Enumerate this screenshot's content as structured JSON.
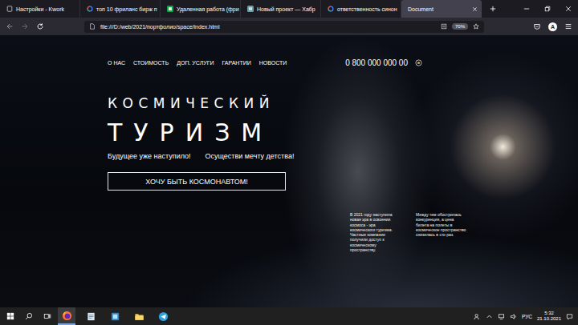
{
  "browser": {
    "tabs": [
      {
        "label": "Настройки - Kwork",
        "kind": "kwork",
        "selected": false
      },
      {
        "label": "топ 10 фриланс бирж п",
        "kind": "google",
        "selected": false
      },
      {
        "label": "Удаленная работа (фри",
        "kind": "fl",
        "selected": false
      },
      {
        "label": "Новый проект — Хабр",
        "kind": "habr",
        "selected": false
      },
      {
        "label": "ответственность синон",
        "kind": "google",
        "selected": false
      },
      {
        "label": "Document",
        "kind": "none",
        "selected": true
      }
    ],
    "url": "file:///D:/web/2021/портфолио/space/index.html",
    "zoom": "70%",
    "account": "A"
  },
  "page": {
    "nav": [
      "О НАС",
      "СТОИМОСТЬ",
      "ДОП. УСЛУГИ",
      "ГАРАНТИИ",
      "НОВОСТИ"
    ],
    "phone": "0 800 000 000 00",
    "title": [
      "КОСМИЧЕСКИЙ",
      "ТУРИЗМ"
    ],
    "taglines": [
      "Будущее уже наступило!",
      "Осуществи мечту детства!"
    ],
    "cta": "ХОЧУ БЫТЬ КОСМОНАВТОМ!",
    "paragraphs": [
      "В 2021 году наступила новая эра в освоении космоса - эра космического туризма. Частные компании получили доступ к космическому пространству.",
      "Между тем обострилась конкуренция, а цена билета на полеты в космическое пространство снизилась в сто раз."
    ]
  },
  "taskbar": {
    "apps": [
      {
        "kind": "firefox",
        "active": true
      },
      {
        "kind": "notepad",
        "active": false
      },
      {
        "kind": "editor",
        "active": false
      },
      {
        "kind": "folder",
        "active": false
      },
      {
        "kind": "telegram",
        "active": false
      }
    ],
    "language": "РУС",
    "time": "5:32",
    "date": "21.10.2021"
  }
}
